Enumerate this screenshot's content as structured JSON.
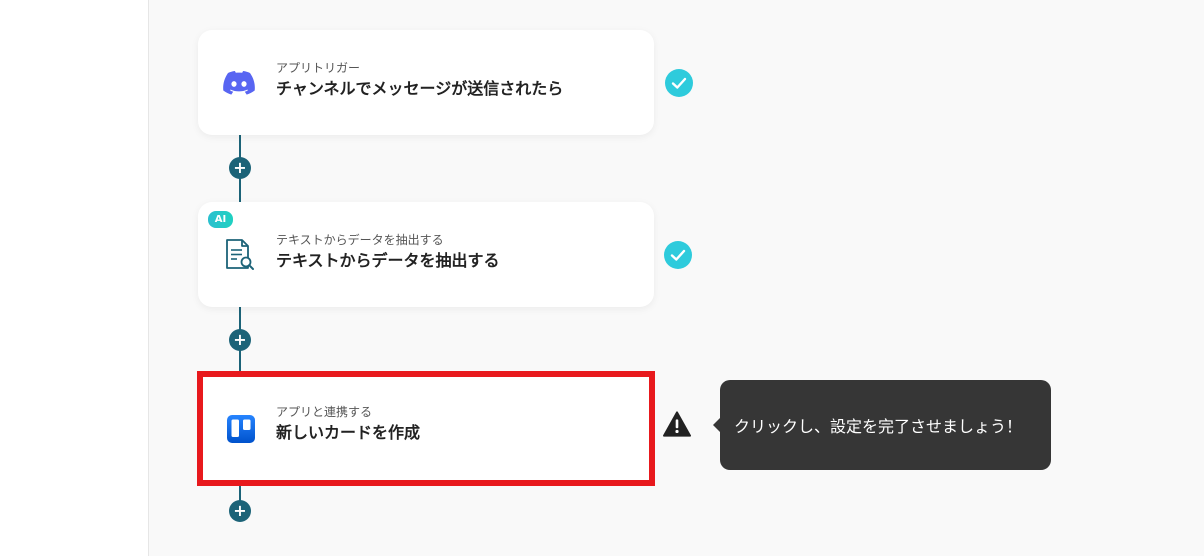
{
  "steps": [
    {
      "subtitle": "アプリトリガー",
      "title": "チャンネルでメッセージが送信されたら",
      "icon": "discord-icon",
      "status": "complete"
    },
    {
      "badge": "AI",
      "subtitle": "テキストからデータを抽出する",
      "title": "テキストからデータを抽出する",
      "icon": "document-search-icon",
      "status": "complete"
    },
    {
      "subtitle": "アプリと連携する",
      "title": "新しいカードを作成",
      "icon": "trello-icon",
      "status": "warning"
    }
  ],
  "tooltip": {
    "text": "クリックし、設定を完了させましょう！"
  },
  "colors": {
    "accent": "#1c6378",
    "check": "#2ecbdc",
    "highlight": "#e8191d",
    "discord": "#5865f2",
    "trello": "#1868db",
    "tooltip_bg": "#363636"
  }
}
